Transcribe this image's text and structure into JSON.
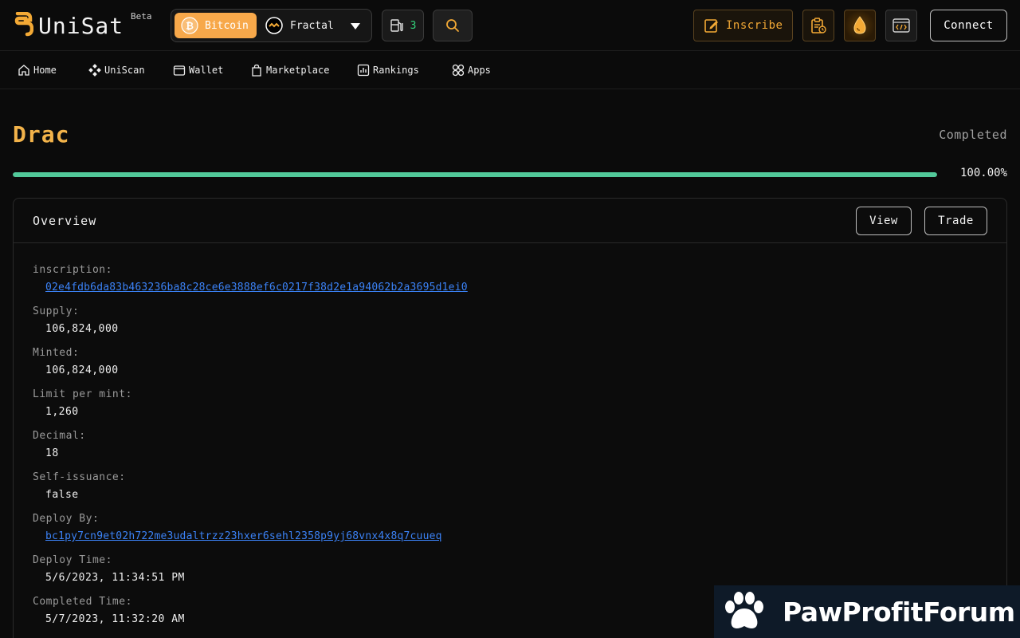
{
  "header": {
    "logo_text": "UniSat",
    "logo_badge": "Beta",
    "network": {
      "active": "Bitcoin",
      "other": "Fractal"
    },
    "gas_count": "3",
    "inscribe_label": "Inscribe",
    "connect_label": "Connect"
  },
  "nav": {
    "items": [
      {
        "label": "Home",
        "icon": "home-icon"
      },
      {
        "label": "UniScan",
        "icon": "uniscan-icon"
      },
      {
        "label": "Wallet",
        "icon": "wallet-icon"
      },
      {
        "label": "Marketplace",
        "icon": "bag-icon"
      },
      {
        "label": "Rankings",
        "icon": "chart-icon"
      },
      {
        "label": "Apps",
        "icon": "apps-icon"
      }
    ]
  },
  "token": {
    "name": "Drac",
    "status": "Completed",
    "progress": 100,
    "progress_label": "100.00%"
  },
  "overview": {
    "title": "Overview",
    "view_label": "View",
    "trade_label": "Trade",
    "fields": [
      {
        "label": "inscription:",
        "value": "02e4fdb6da83b463236ba8c28ce6e3888ef6c0217f38d2e1a94062b2a3695d1ei0",
        "link": true
      },
      {
        "label": "Supply:",
        "value": "106,824,000",
        "link": false
      },
      {
        "label": "Minted:",
        "value": "106,824,000",
        "link": false
      },
      {
        "label": "Limit per mint:",
        "value": "1,260",
        "link": false
      },
      {
        "label": "Decimal:",
        "value": "18",
        "link": false
      },
      {
        "label": "Self-issuance:",
        "value": "false",
        "link": false
      },
      {
        "label": "Deploy By:",
        "value": "bc1py7cn9et02h722me3udaltrzz23hxer6sehl2358p9yj68vnx4x8q7cuueq",
        "link": true
      },
      {
        "label": "Deploy Time:",
        "value": "5/6/2023, 11:34:51 PM",
        "link": false
      },
      {
        "label": "Completed Time:",
        "value": "5/7/2023, 11:32:20 AM",
        "link": false
      }
    ]
  },
  "watermark": {
    "text": "PawProfitForum"
  },
  "colors": {
    "accent": "#f3b34a",
    "bitcoin": "#f7a84a",
    "progress": "#52c99a",
    "link": "#3b82f6",
    "gas": "#33d07a"
  }
}
